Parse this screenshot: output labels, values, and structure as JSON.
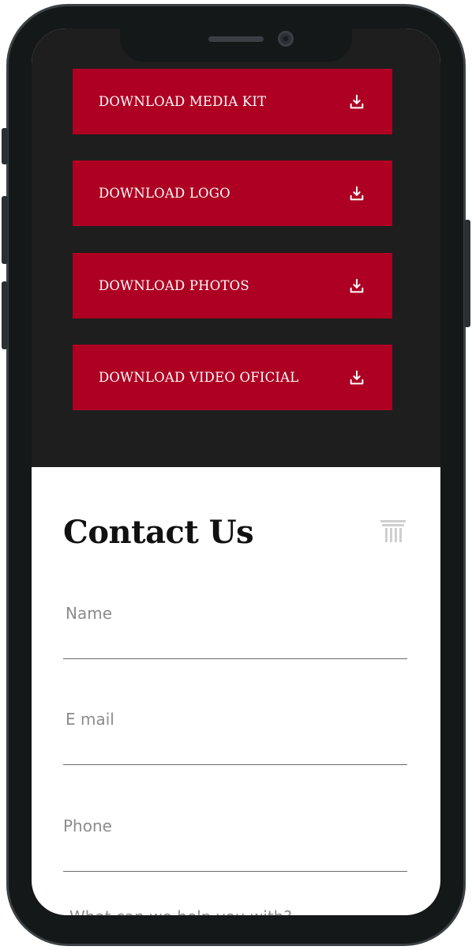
{
  "downloads": [
    {
      "label": "DOWNLOAD MEDIA KIT",
      "icon": "download-icon"
    },
    {
      "label": "DOWNLOAD LOGO",
      "icon": "download-icon"
    },
    {
      "label": "DOWNLOAD PHOTOS",
      "icon": "download-icon"
    },
    {
      "label": "DOWNLOAD VIDEO OFICIAL",
      "icon": "download-icon"
    }
  ],
  "contact": {
    "title": "Contact Us",
    "icon": "column-icon",
    "fields": [
      {
        "label": "Name",
        "value": ""
      },
      {
        "label": "E mail",
        "value": ""
      },
      {
        "label": "Phone",
        "value": ""
      }
    ],
    "next_question_partial": "What can we help you with?"
  },
  "colors": {
    "accent": "#ae0022",
    "dark_background": "#1e1e1e",
    "frame": "#141819"
  }
}
